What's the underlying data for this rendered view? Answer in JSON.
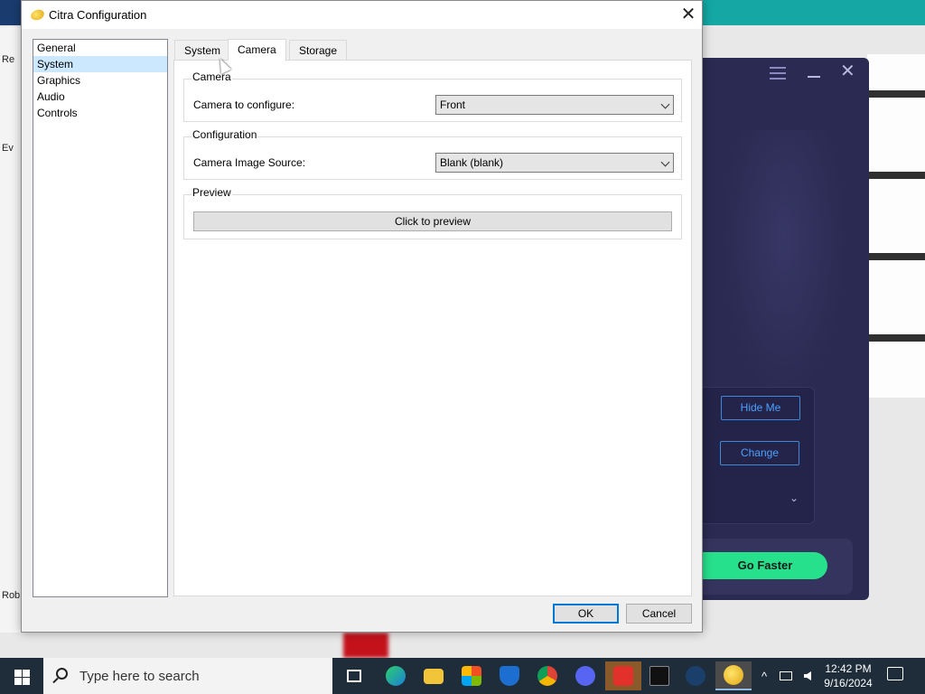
{
  "dialog": {
    "title": "Citra Configuration",
    "close_glyph": "✕",
    "nav_items": [
      "General",
      "System",
      "Graphics",
      "Audio",
      "Controls"
    ],
    "selected_nav": "System",
    "tabs": [
      "System",
      "Camera",
      "Storage"
    ],
    "active_tab": "Camera",
    "camera_group": {
      "title": "Camera",
      "label": "Camera to configure:",
      "value": "Front"
    },
    "config_group": {
      "title": "Configuration",
      "label": "Camera Image Source:",
      "value": "Blank (blank)"
    },
    "preview_group": {
      "title": "Preview",
      "button": "Click to preview"
    },
    "ok": "OK",
    "cancel": "Cancel"
  },
  "vpn_app": {
    "hide_me": "Hide Me",
    "change": "Change",
    "go_faster": "Go Faster",
    "chevron": "⌄"
  },
  "desktop_labels": [
    "Re",
    "Ev",
    "Rob"
  ],
  "taskbar": {
    "search_placeholder": "Type here to search",
    "time": "12:42 PM",
    "date": "9/16/2024",
    "tray_chevron": "^"
  },
  "colors": {
    "accent": "#0078d7",
    "vpn_bg": "#2b2a52",
    "go_green": "#27e08c",
    "taskbar": "#1f2c3a"
  }
}
